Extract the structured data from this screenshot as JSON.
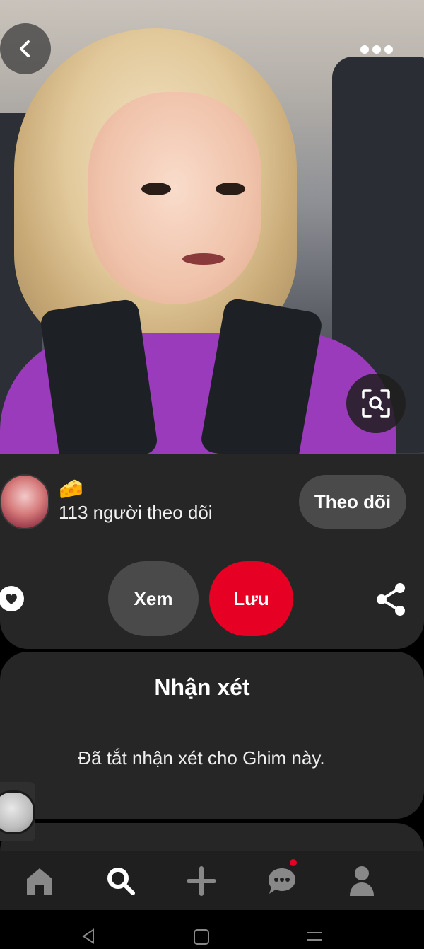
{
  "pin": {
    "image_description_icon": "photo-image",
    "back_icon": "chevron-left-icon",
    "more_icon": "more-horizontal-icon",
    "visual_search_icon": "lens-search-icon"
  },
  "creator": {
    "emoji": "🧀",
    "followers": "113 người theo dõi",
    "follow_label": "Theo dõi"
  },
  "actions": {
    "view_label": "Xem",
    "save_label": "Lưu"
  },
  "comments": {
    "title": "Nhận xét",
    "disabled_text": "Đã tắt nhận xét cho Ghim này."
  },
  "nav": {
    "items": [
      "home-icon",
      "search-icon",
      "add-icon",
      "messages-icon",
      "profile-icon"
    ]
  },
  "colors": {
    "accent": "#e60023",
    "surface": "#262626",
    "button_gray": "#4a4a4a",
    "background": "#000000"
  }
}
